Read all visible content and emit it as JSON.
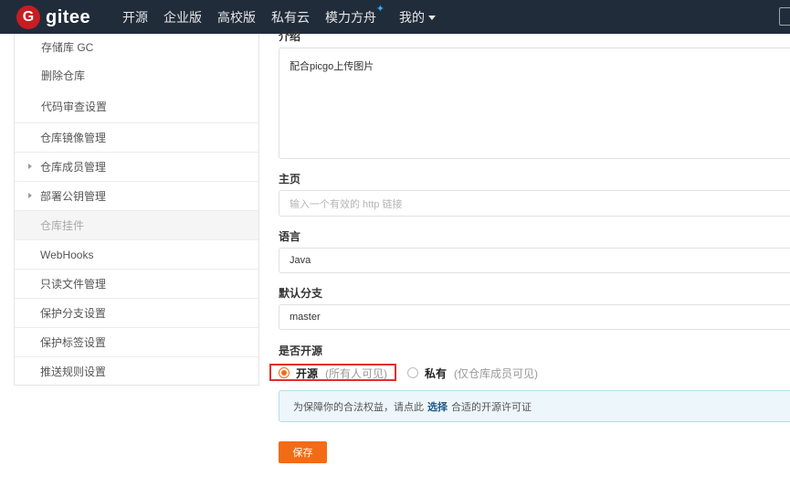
{
  "nav": {
    "logo_letter": "G",
    "logo_text": "gitee",
    "items": [
      "开源",
      "企业版",
      "高校版",
      "私有云",
      "模力方舟"
    ],
    "star": "✦",
    "me": "我的"
  },
  "sidebar": {
    "items": [
      {
        "label": "存储库 GC"
      },
      {
        "label": "删除仓库"
      },
      {
        "label": "代码审查设置"
      }
    ],
    "groups": [
      {
        "label": "仓库镜像管理"
      },
      {
        "label": "仓库成员管理"
      },
      {
        "label": "部署公钥管理"
      },
      {
        "label": "仓库挂件"
      },
      {
        "label": "WebHooks"
      },
      {
        "label": "只读文件管理"
      },
      {
        "label": "保护分支设置"
      },
      {
        "label": "保护标签设置"
      },
      {
        "label": "推送规则设置"
      }
    ]
  },
  "form": {
    "intro_label": "介绍",
    "intro_value": "配合picgo上传图片",
    "homepage_label": "主页",
    "homepage_placeholder": "输入一个有效的 http 链接",
    "language_label": "语言",
    "language_value": "Java",
    "branch_label": "默认分支",
    "branch_value": "master",
    "open_label": "是否开源",
    "open_option": "开源",
    "open_hint": "(所有人可见)",
    "private_option": "私有",
    "private_hint": "(仅仓库成员可见)",
    "notice_before": "为保障你的合法权益，请点此",
    "notice_link": "选择",
    "notice_after": "合适的开源许可证",
    "save": "保存"
  },
  "colors": {
    "nav_bg": "#212c3b",
    "brand_red": "#c71d23",
    "accent_orange": "#f46b17",
    "highlight_red": "#e0302a"
  }
}
